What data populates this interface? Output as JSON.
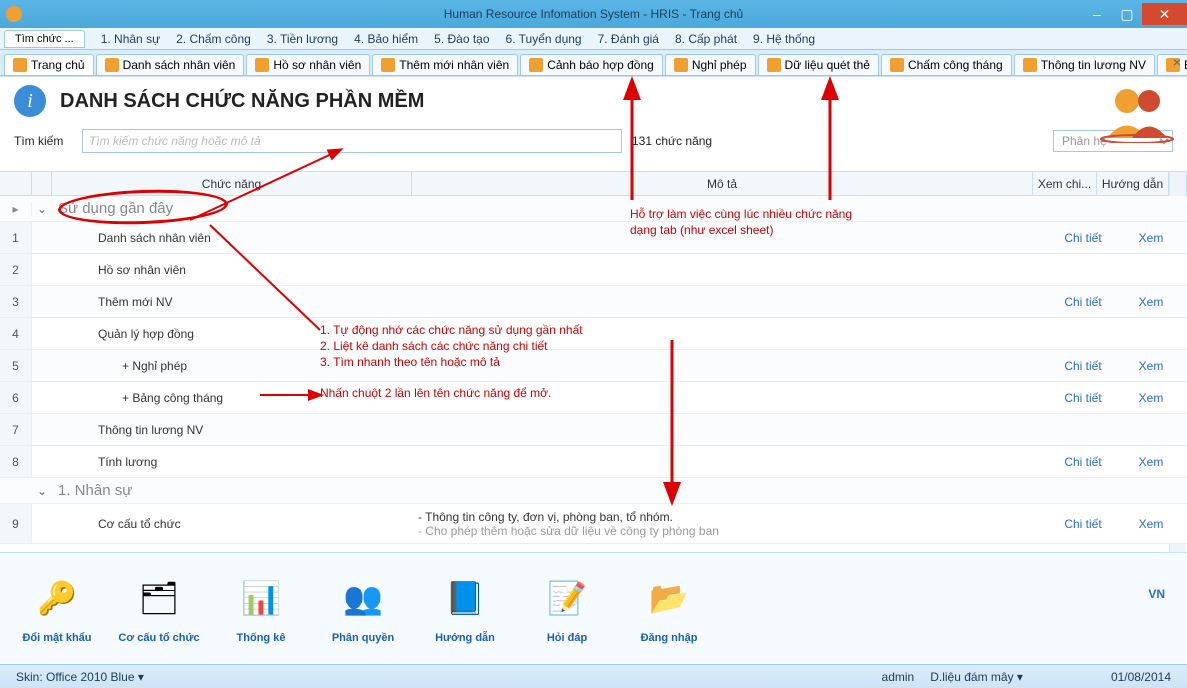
{
  "window": {
    "title": "Human Resource Infomation System - HRIS - Trang chủ"
  },
  "nav": {
    "small_tab": "Tìm chức ...",
    "menus": [
      "1.  Nhân sự",
      "2.  Chấm công",
      "3.  Tiền lương",
      "4.  Bảo hiểm",
      "5.  Đào tạo",
      "6.  Tuyển dụng",
      "7.  Đánh giá",
      "8.  Cấp phát",
      "9.  Hệ thống"
    ]
  },
  "tabs": [
    "Trang chủ",
    "Danh sách nhân viên",
    "Hồ sơ nhân viên",
    "Thêm mới nhân viên",
    "Cảnh báo hợp đồng",
    "Nghỉ phép",
    "Dữ liệu quét thẻ",
    "Chấm công tháng",
    "Thông tin lương NV",
    "Bảng lương chi tiết"
  ],
  "page": {
    "title": "DANH SÁCH CHỨC NĂNG PHẦN MỀM",
    "search_label": "Tìm kiếm",
    "search_placeholder": "Tìm kiếm chức năng hoặc mô tả",
    "count": "131 chức năng",
    "phanhe_placeholder": "Phân hệ"
  },
  "grid": {
    "headers": {
      "func": "Chức năng",
      "desc": "Mô tả",
      "detail": "Xem chi...",
      "guide": "Hướng dẫn"
    },
    "group1": "Sử dụng gần đây",
    "group2": "1.  Nhân sự",
    "rows": [
      {
        "n": "1",
        "name": "Danh sách nhân viên",
        "desc": "",
        "detail": "Chi tiết",
        "guide": "Xem"
      },
      {
        "n": "2",
        "name": "Hồ sơ nhân viên",
        "desc": "",
        "detail": "",
        "guide": ""
      },
      {
        "n": "3",
        "name": "Thêm mới NV",
        "desc": "",
        "detail": "Chi tiết",
        "guide": "Xem"
      },
      {
        "n": "4",
        "name": "Quản lý hợp đồng",
        "desc": "",
        "detail": "",
        "guide": ""
      },
      {
        "n": "5",
        "name": "+ Nghỉ phép",
        "indent": true,
        "desc": "",
        "detail": "Chi tiết",
        "guide": "Xem"
      },
      {
        "n": "6",
        "name": "+ Bảng công tháng",
        "indent": true,
        "desc": "",
        "detail": "Chi tiết",
        "guide": "Xem"
      },
      {
        "n": "7",
        "name": "Thông tin lương NV",
        "desc": "",
        "detail": "",
        "guide": ""
      },
      {
        "n": "8",
        "name": "Tính lương",
        "desc": "",
        "detail": "Chi tiết",
        "guide": "Xem"
      }
    ],
    "row9": {
      "n": "9",
      "name": "Cơ cấu tổ chức",
      "desc1": "- Thông tin công ty, đơn vị, phòng ban, tổ nhóm.",
      "desc2": "- Cho phép thêm hoặc sửa dữ liệu về công ty phòng ban",
      "detail": "Chi tiết",
      "guide": "Xem"
    }
  },
  "toolbar": {
    "items": [
      {
        "label": "Đổi mật khẩu",
        "icon": "🔑"
      },
      {
        "label": "Cơ cấu tổ chức",
        "icon": "🗂"
      },
      {
        "label": "Thống kê",
        "icon": "📊"
      },
      {
        "label": "Phân quyền",
        "icon": "👥"
      },
      {
        "label": "Hướng dẫn",
        "icon": "📘"
      },
      {
        "label": "Hỏi đáp",
        "icon": "📝"
      },
      {
        "label": "Đăng nhập",
        "icon": "📂"
      }
    ],
    "lang": "VN"
  },
  "status": {
    "skin": "Skin: Office 2010 Blue ▾",
    "user": "admin",
    "sync": "D.liệu đám mây ▾",
    "date": "01/08/2014"
  },
  "annotations": {
    "tabs_note_l1": "Hỗ trợ làm việc cùng lúc nhiều chức năng",
    "tabs_note_l2": "dạng tab (như excel sheet)",
    "center_l1": "1. Tự động nhớ các chức năng sử dụng gần nhất",
    "center_l2": "2. Liệt kê danh sách các chức năng chi tiết",
    "center_l3": "3. Tìm nhanh theo tên hoặc mô tả",
    "center_l4": "Nhấn chuột 2 lần lên tên chức năng để mở."
  }
}
